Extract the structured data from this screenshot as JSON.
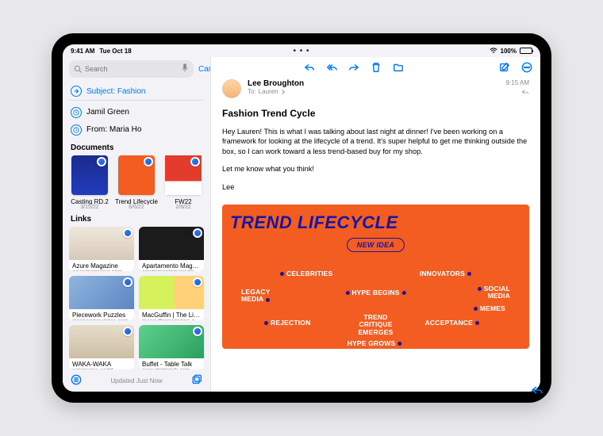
{
  "status": {
    "time": "9:41 AM",
    "date": "Tue Oct 18",
    "battery": "100%"
  },
  "search": {
    "placeholder": "Search",
    "cancel": "Cancel"
  },
  "filters": [
    {
      "label": "Subject: Fashion",
      "icon": "arrow-right"
    },
    {
      "label": "Jamil Green",
      "icon": "clock"
    },
    {
      "label": "From: Maria Ho",
      "icon": "clock"
    }
  ],
  "sections": {
    "documents": "Documents",
    "links": "Links"
  },
  "documents": [
    {
      "title": "Casting RD.2",
      "date": "3/15/22"
    },
    {
      "title": "Trend Lifecycle",
      "date": "6/6/22"
    },
    {
      "title": "FW22",
      "date": "2/8/22"
    }
  ],
  "links": [
    {
      "title": "Azure Magazine",
      "host": "azuremagazine.com"
    },
    {
      "title": "Apartamento Maga…",
      "host": "apartamentomagazine.com"
    },
    {
      "title": "Piecework Puzzles",
      "host": "pieceworkpuzzles.com"
    },
    {
      "title": "MacGuffin | The Lif…",
      "host": "macguffinmagazine.com"
    },
    {
      "title": "WAKA-WAKA",
      "host": "wakawaka.world"
    },
    {
      "title": "Buffet - Table Talk",
      "host": "pinourtabletalk.com"
    }
  ],
  "footer": {
    "updated": "Updated Just Now"
  },
  "mail": {
    "from": "Lee Broughton",
    "to_label": "To:",
    "to_name": "Lauren",
    "time": "9:15 AM",
    "subject": "Fashion Trend Cycle",
    "p1": "Hey Lauren! This is what I was talking about last night at dinner! I've been working on a framework for looking at the lifecycle of a trend. It's super helpful to get me thinking outside the box, so I can work toward a less trend-based buy for my shop.",
    "p2": "Let me know what you think!",
    "p3": "Lee"
  },
  "attachment": {
    "title": "TREND LIFECYCLE",
    "chip": "NEW IDEA",
    "nodes": {
      "celebrities": "CELEBRITIES",
      "innovators": "INNOVATORS",
      "legacy": "LEGACY MEDIA",
      "hype_begins": "HYPE BEGINS",
      "social": "SOCIAL MEDIA",
      "memes": "MEMES",
      "rejection": "REJECTION",
      "critique": "TREND CRITIQUE EMERGES",
      "acceptance": "ACCEPTANCE",
      "hype_grows": "HYPE GROWS"
    }
  }
}
